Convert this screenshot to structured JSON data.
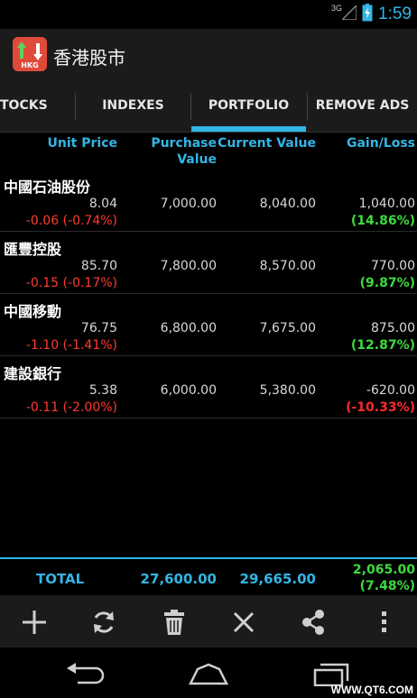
{
  "status": {
    "network": "3G",
    "time": "1:59"
  },
  "app": {
    "title": "香港股市",
    "icon_label": "HKG"
  },
  "tabs": [
    {
      "label": "TOCKS",
      "active": false
    },
    {
      "label": "INDEXES",
      "active": false
    },
    {
      "label": "PORTFOLIO",
      "active": true
    },
    {
      "label": "REMOVE ADS",
      "active": false
    }
  ],
  "columns": {
    "unit_price": "Unit Price",
    "purchase_line1": "Purchase",
    "purchase_line2": "Value",
    "current_value": "Current Value",
    "gain_loss": "Gain/Loss"
  },
  "rows": [
    {
      "name": "中國石油股份",
      "price": "8.04",
      "change": "-0.06 (-0.74%)",
      "purchase": "7,000.00",
      "current": "8,040.00",
      "gain": "1,040.00",
      "gain_pct": "(14.86%)",
      "positive": true
    },
    {
      "name": "匯豐控股",
      "price": "85.70",
      "change": "-0.15 (-0.17%)",
      "purchase": "7,800.00",
      "current": "8,570.00",
      "gain": "770.00",
      "gain_pct": "(9.87%)",
      "positive": true
    },
    {
      "name": "中國移動",
      "price": "76.75",
      "change": "-1.10 (-1.41%)",
      "purchase": "6,800.00",
      "current": "7,675.00",
      "gain": "875.00",
      "gain_pct": "(12.87%)",
      "positive": true
    },
    {
      "name": "建設銀行",
      "price": "5.38",
      "change": "-0.11 (-2.00%)",
      "purchase": "6,000.00",
      "current": "5,380.00",
      "gain": "-620.00",
      "gain_pct": "(-10.33%)",
      "positive": false
    }
  ],
  "total": {
    "label": "TOTAL",
    "purchase": "27,600.00",
    "current": "29,665.00",
    "gain": "2,065.00",
    "gain_pct": "(7.48%)"
  },
  "toolbar": {
    "icons": [
      "add-icon",
      "refresh-icon",
      "delete-icon",
      "close-icon",
      "share-icon",
      "overflow-menu-icon"
    ]
  },
  "navigation": {
    "icons": [
      "back-icon",
      "home-icon",
      "recents-icon"
    ]
  },
  "watermark": "WWW.QT6.COM",
  "colors": {
    "accent": "#33b5e5",
    "positive": "#3ddc3d",
    "negative": "#ff2a2a",
    "background": "#000000"
  }
}
